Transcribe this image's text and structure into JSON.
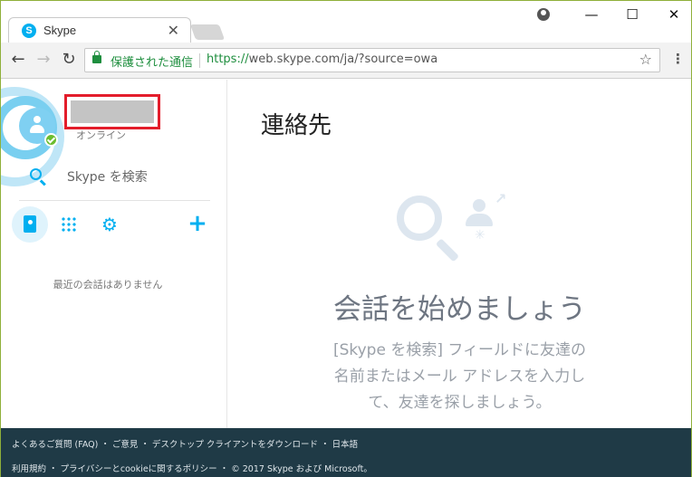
{
  "browser": {
    "tab_title": "Skype",
    "tab_icon_letter": "S",
    "tab_close": "✕",
    "secure_label": "保護された通信",
    "url_scheme": "https://",
    "url_rest": "web.skype.com/ja/?source=owa",
    "window_controls": {
      "minimize": "—",
      "maximize": "☐",
      "close": "✕"
    },
    "nav": {
      "back": "←",
      "forward": "→",
      "reload": "↻",
      "bookmark": "☆",
      "menu": "⋮"
    }
  },
  "sidebar": {
    "presence": "オンライン",
    "search_label": "Skype を検索",
    "empty_recent": "最近の会話はありません",
    "settings_glyph": "⚙",
    "add_glyph": "+"
  },
  "main": {
    "title": "連絡先",
    "headline": "会話を始めましょう",
    "body_line1": "[Skype を検索] フィールドに友達の",
    "body_line2": "名前またはメール アドレスを入力し",
    "body_line3": "て、友達を探しましょう。",
    "arrow_glyph": "↗",
    "sparkle_glyph": "✳"
  },
  "footer": {
    "line1": "よくあるご質問 (FAQ) ・ ご意見 ・ デスクトップ クライアントをダウンロード ・ 日本語",
    "line2": "利用規約 ・ プライバシーとcookieに関するポリシー ・ © 2017 Skype および Microsoft。"
  }
}
